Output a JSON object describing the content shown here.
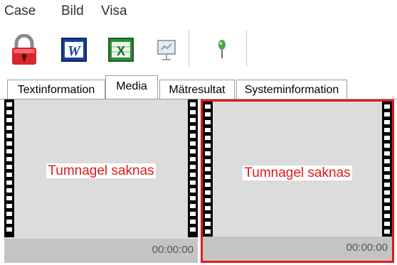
{
  "menu": {
    "items": [
      "Case",
      "Bild",
      "Visa"
    ]
  },
  "toolbar": {
    "buttons": [
      {
        "icon": "lock-icon"
      },
      {
        "icon": "word-icon",
        "glyph": "W"
      },
      {
        "icon": "excel-icon",
        "glyph": "X"
      },
      {
        "icon": "presentation-icon"
      },
      {
        "icon": "pin-icon"
      }
    ]
  },
  "tabs": [
    {
      "label": "Textinformation",
      "active": false
    },
    {
      "label": "Media",
      "active": true
    },
    {
      "label": "Mätresultat",
      "active": false
    },
    {
      "label": "Systeminformation",
      "active": false
    }
  ],
  "media": {
    "items": [
      {
        "placeholder": "Tumnagel saknas",
        "time": "00:00:00",
        "selected": false
      },
      {
        "placeholder": "Tumnagel saknas",
        "time": "00:00:00",
        "selected": true
      }
    ]
  },
  "colors": {
    "selection": "#e0191b",
    "placeholder_text": "#e0191b",
    "frame_bg": "#dcdcdc",
    "footer_bg": "#c4c4c4"
  }
}
